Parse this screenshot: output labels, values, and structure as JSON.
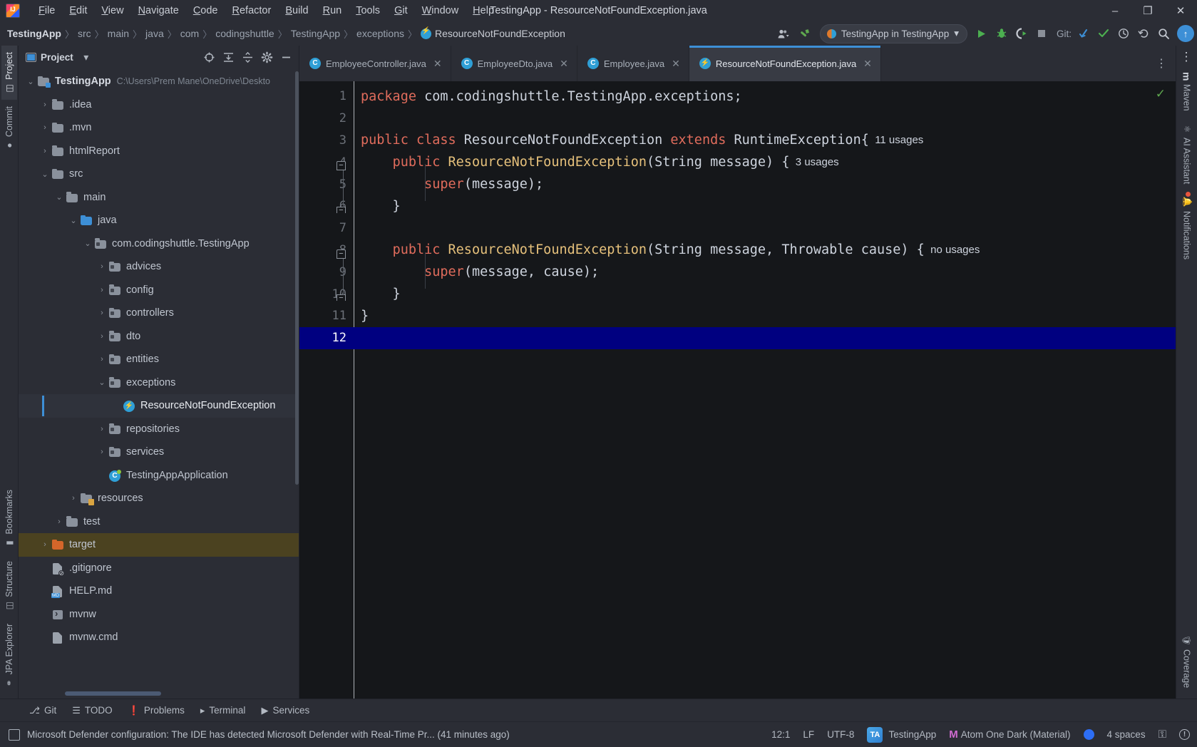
{
  "window": {
    "title": "TestingApp - ResourceNotFoundException.java",
    "minimize": "–",
    "maximize": "❐",
    "close": "✕"
  },
  "menubar": {
    "items": [
      "File",
      "Edit",
      "View",
      "Navigate",
      "Code",
      "Refactor",
      "Build",
      "Run",
      "Tools",
      "Git",
      "Window",
      "Help"
    ]
  },
  "breadcrumb": {
    "items": [
      "TestingApp",
      "src",
      "main",
      "java",
      "com",
      "codingshuttle",
      "TestingApp",
      "exceptions",
      "ResourceNotFoundException"
    ],
    "separator": "〉"
  },
  "toolbar": {
    "account_label": "▾",
    "build_hammer": "build-icon",
    "run_config": "TestingApp in TestingApp",
    "run_config_caret": "▾",
    "run": "▶",
    "debug": "debug-icon",
    "run_with_coverage": "coverage-icon",
    "stop": "■",
    "git_label": "Git:",
    "git_update": "↙",
    "git_commit": "✓",
    "git_history": "◴",
    "git_rollback": "↺",
    "search": "⌕",
    "update_arrow": "↑"
  },
  "project_panel": {
    "title": "Project",
    "dropdown_caret": "▾",
    "actions": [
      "select-opened-file-icon",
      "expand-all-icon",
      "collapse-all-icon",
      "settings-icon",
      "hide-icon"
    ],
    "tree": [
      {
        "label": "TestingApp",
        "path": "C:\\Users\\Prem Mane\\OneDrive\\Deskto",
        "indent": 0,
        "arrow": "⌄",
        "icon": "module",
        "bold": true
      },
      {
        "label": ".idea",
        "indent": 1,
        "arrow": "›",
        "icon": "folder"
      },
      {
        "label": ".mvn",
        "indent": 1,
        "arrow": "›",
        "icon": "folder"
      },
      {
        "label": "htmlReport",
        "indent": 1,
        "arrow": "›",
        "icon": "folder"
      },
      {
        "label": "src",
        "indent": 1,
        "arrow": "⌄",
        "icon": "folder"
      },
      {
        "label": "main",
        "indent": 2,
        "arrow": "⌄",
        "icon": "folder"
      },
      {
        "label": "java",
        "indent": 3,
        "arrow": "⌄",
        "icon": "source"
      },
      {
        "label": "com.codingshuttle.TestingApp",
        "indent": 4,
        "arrow": "⌄",
        "icon": "package"
      },
      {
        "label": "advices",
        "indent": 5,
        "arrow": "›",
        "icon": "package"
      },
      {
        "label": "config",
        "indent": 5,
        "arrow": "›",
        "icon": "package"
      },
      {
        "label": "controllers",
        "indent": 5,
        "arrow": "›",
        "icon": "package"
      },
      {
        "label": "dto",
        "indent": 5,
        "arrow": "›",
        "icon": "package"
      },
      {
        "label": "entities",
        "indent": 5,
        "arrow": "›",
        "icon": "package"
      },
      {
        "label": "exceptions",
        "indent": 5,
        "arrow": "⌄",
        "icon": "package"
      },
      {
        "label": "ResourceNotFoundException",
        "indent": 6,
        "arrow": "",
        "icon": "exception-class",
        "selected": true
      },
      {
        "label": "repositories",
        "indent": 5,
        "arrow": "›",
        "icon": "package"
      },
      {
        "label": "services",
        "indent": 5,
        "arrow": "›",
        "icon": "package"
      },
      {
        "label": "TestingAppApplication",
        "indent": 5,
        "arrow": "",
        "icon": "spring-class"
      },
      {
        "label": "resources",
        "indent": 3,
        "arrow": "›",
        "icon": "resources"
      },
      {
        "label": "test",
        "indent": 2,
        "arrow": "›",
        "icon": "folder"
      },
      {
        "label": "target",
        "indent": 1,
        "arrow": "›",
        "icon": "folder-orange",
        "highlight": true
      },
      {
        "label": ".gitignore",
        "indent": 1,
        "arrow": "",
        "icon": "gitignore-file"
      },
      {
        "label": "HELP.md",
        "indent": 1,
        "arrow": "",
        "icon": "md-file"
      },
      {
        "label": "mvnw",
        "indent": 1,
        "arrow": "",
        "icon": "shell-file"
      },
      {
        "label": "mvnw.cmd",
        "indent": 1,
        "arrow": "",
        "icon": "file"
      }
    ]
  },
  "left_stripe": {
    "top": [
      {
        "label": "Project",
        "icon": "project-icon",
        "active": true
      },
      {
        "label": "Commit",
        "icon": "commit-icon",
        "active": false
      }
    ],
    "bottom": [
      {
        "label": "Bookmarks",
        "icon": "bookmark-icon"
      },
      {
        "label": "Structure",
        "icon": "structure-icon"
      },
      {
        "label": "JPA Explorer",
        "icon": "jpa-icon"
      }
    ]
  },
  "right_stripe": {
    "top": [
      {
        "label": "Maven",
        "icon": "maven-icon"
      },
      {
        "label": "AI Assistant",
        "icon": "ai-assistant-icon"
      },
      {
        "label": "Notifications",
        "icon": "notifications-icon",
        "badge": true
      }
    ],
    "bottom": [
      {
        "label": "Coverage",
        "icon": "coverage-shield-icon"
      }
    ]
  },
  "editor": {
    "tabs": [
      {
        "label": "EmployeeController.java",
        "icon": "java-class-icon",
        "active": false,
        "close": "✕"
      },
      {
        "label": "EmployeeDto.java",
        "icon": "java-class-icon",
        "active": false,
        "close": "✕"
      },
      {
        "label": "Employee.java",
        "icon": "java-class-icon",
        "active": false,
        "close": "✕"
      },
      {
        "label": "ResourceNotFoundException.java",
        "icon": "exception-class-icon",
        "active": true,
        "close": "✕"
      }
    ],
    "more_tabs": "⋮",
    "inspection_status": "✓",
    "lines": [
      {
        "n": "1",
        "tokens": [
          {
            "t": "package",
            "c": "kw2"
          },
          {
            "t": " com.codingshuttle.TestingApp.exceptions;",
            "c": "plain"
          }
        ]
      },
      {
        "n": "2",
        "tokens": []
      },
      {
        "n": "3",
        "tokens": [
          {
            "t": "public ",
            "c": "kw2"
          },
          {
            "t": "class ",
            "c": "kw2"
          },
          {
            "t": "ResourceNotFoundException ",
            "c": "plain"
          },
          {
            "t": "extends ",
            "c": "kw2"
          },
          {
            "t": "RuntimeException{",
            "c": "plain"
          },
          {
            "t": "  11 usages",
            "c": "inlay"
          }
        ]
      },
      {
        "n": "4",
        "tokens": [
          {
            "t": "    ",
            "c": "plain"
          },
          {
            "t": "public ",
            "c": "kw2"
          },
          {
            "t": "ResourceNotFoundException",
            "c": "typ"
          },
          {
            "t": "(String message) {",
            "c": "plain"
          },
          {
            "t": "  3 usages",
            "c": "inlay"
          }
        ]
      },
      {
        "n": "5",
        "tokens": [
          {
            "t": "        ",
            "c": "plain"
          },
          {
            "t": "super",
            "c": "kw2"
          },
          {
            "t": "(message);",
            "c": "plain"
          }
        ]
      },
      {
        "n": "6",
        "tokens": [
          {
            "t": "    }",
            "c": "plain"
          }
        ]
      },
      {
        "n": "7",
        "tokens": []
      },
      {
        "n": "8",
        "tokens": [
          {
            "t": "    ",
            "c": "plain"
          },
          {
            "t": "public ",
            "c": "kw2"
          },
          {
            "t": "ResourceNotFoundException",
            "c": "typ"
          },
          {
            "t": "(String message, Throwable cause) {",
            "c": "plain"
          },
          {
            "t": "  no usages",
            "c": "inlay"
          }
        ]
      },
      {
        "n": "9",
        "tokens": [
          {
            "t": "        ",
            "c": "plain"
          },
          {
            "t": "super",
            "c": "kw2"
          },
          {
            "t": "(message, cause);",
            "c": "plain"
          }
        ]
      },
      {
        "n": "10",
        "tokens": [
          {
            "t": "    }",
            "c": "plain"
          }
        ]
      },
      {
        "n": "11",
        "tokens": [
          {
            "t": "}",
            "c": "plain"
          }
        ]
      },
      {
        "n": "12",
        "tokens": [],
        "current": true
      }
    ],
    "fold_markers": [
      {
        "line": 4,
        "type": "top"
      },
      {
        "line": 6,
        "type": "bot"
      },
      {
        "line": 8,
        "type": "top"
      },
      {
        "line": 10,
        "type": "bot"
      }
    ]
  },
  "bottom_stripe": {
    "tabs": [
      {
        "label": "Git",
        "icon": "git-branch-icon"
      },
      {
        "label": "TODO",
        "icon": "todo-list-icon"
      },
      {
        "label": "Problems",
        "icon": "problems-icon"
      },
      {
        "label": "Terminal",
        "icon": "terminal-icon"
      },
      {
        "label": "Services",
        "icon": "services-icon"
      }
    ]
  },
  "statusbar": {
    "message": "Microsoft Defender configuration: The IDE has detected Microsoft Defender with Real-Time Pr... (41 minutes ago)",
    "caret_position": "12:1",
    "line_separator": "LF",
    "encoding": "UTF-8",
    "module_badge": "TA",
    "module": "TestingApp",
    "theme_marker": "M",
    "theme": "Atom One Dark (Material)",
    "indent": "4 spaces",
    "lock_icon": "⚿",
    "warn_icon": "!"
  },
  "colors": {
    "accent_blue": "#3d8fd6",
    "editor_bg": "#15171a",
    "panel_bg": "#2b2d35",
    "current_line": "#000080",
    "keyword": "#e06c5c",
    "type": "#e5c07b",
    "text": "#cdd3dd",
    "target_highlight": "#4b4220",
    "green_run": "#5fa84f"
  }
}
